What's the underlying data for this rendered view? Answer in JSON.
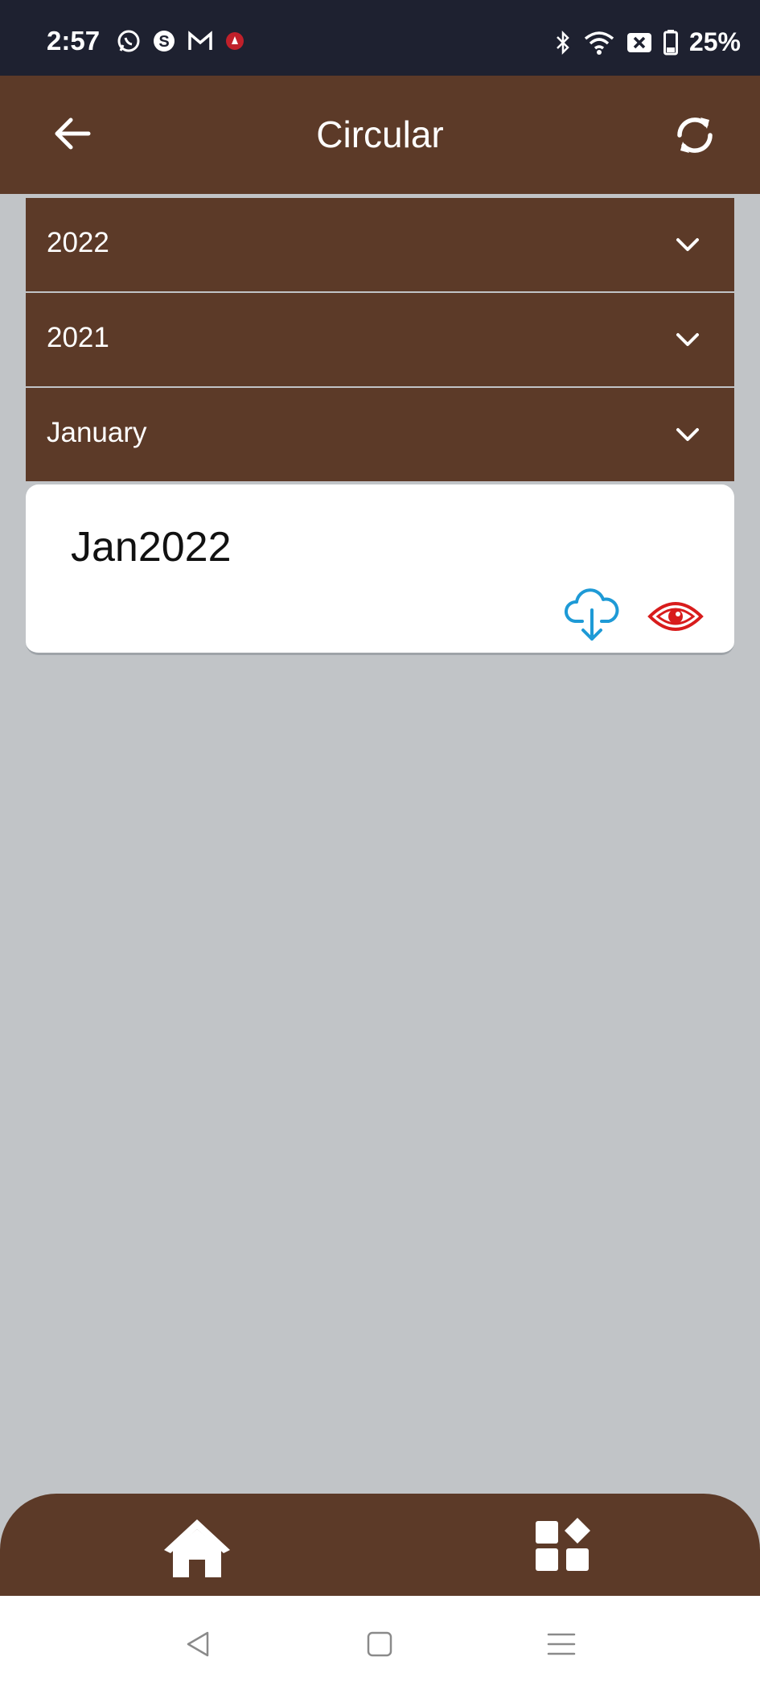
{
  "status_bar": {
    "time": "2:57",
    "left_icons": [
      "whatsapp-icon",
      "skype-icon",
      "gmail-icon",
      "notification-icon"
    ],
    "right_icons": [
      "bluetooth-icon",
      "wifi-icon",
      "sim-off-icon",
      "battery-icon"
    ],
    "battery": "25%"
  },
  "app_bar": {
    "title": "Circular",
    "back_icon": "arrow-left-icon",
    "refresh_icon": "refresh-icon"
  },
  "accordions": [
    {
      "label": "2022",
      "icon": "chevron-down-icon"
    },
    {
      "label": "2021",
      "icon": "chevron-down-icon"
    },
    {
      "label": "January",
      "icon": "chevron-down-icon"
    }
  ],
  "circular_item": {
    "title": "Jan2022",
    "download_icon": "cloud-download-icon",
    "view_icon": "eye-icon"
  },
  "bottom_nav": {
    "home_icon": "home-icon",
    "grid_icon": "apps-grid-icon"
  },
  "system_nav": [
    "back-triangle-icon",
    "home-square-icon",
    "menu-lines-icon"
  ],
  "colors": {
    "primary": "#5c3a28",
    "background": "#c1c4c7",
    "status_bar": "#1e2130",
    "download": "#1e9ad6",
    "view": "#d81c1c"
  }
}
